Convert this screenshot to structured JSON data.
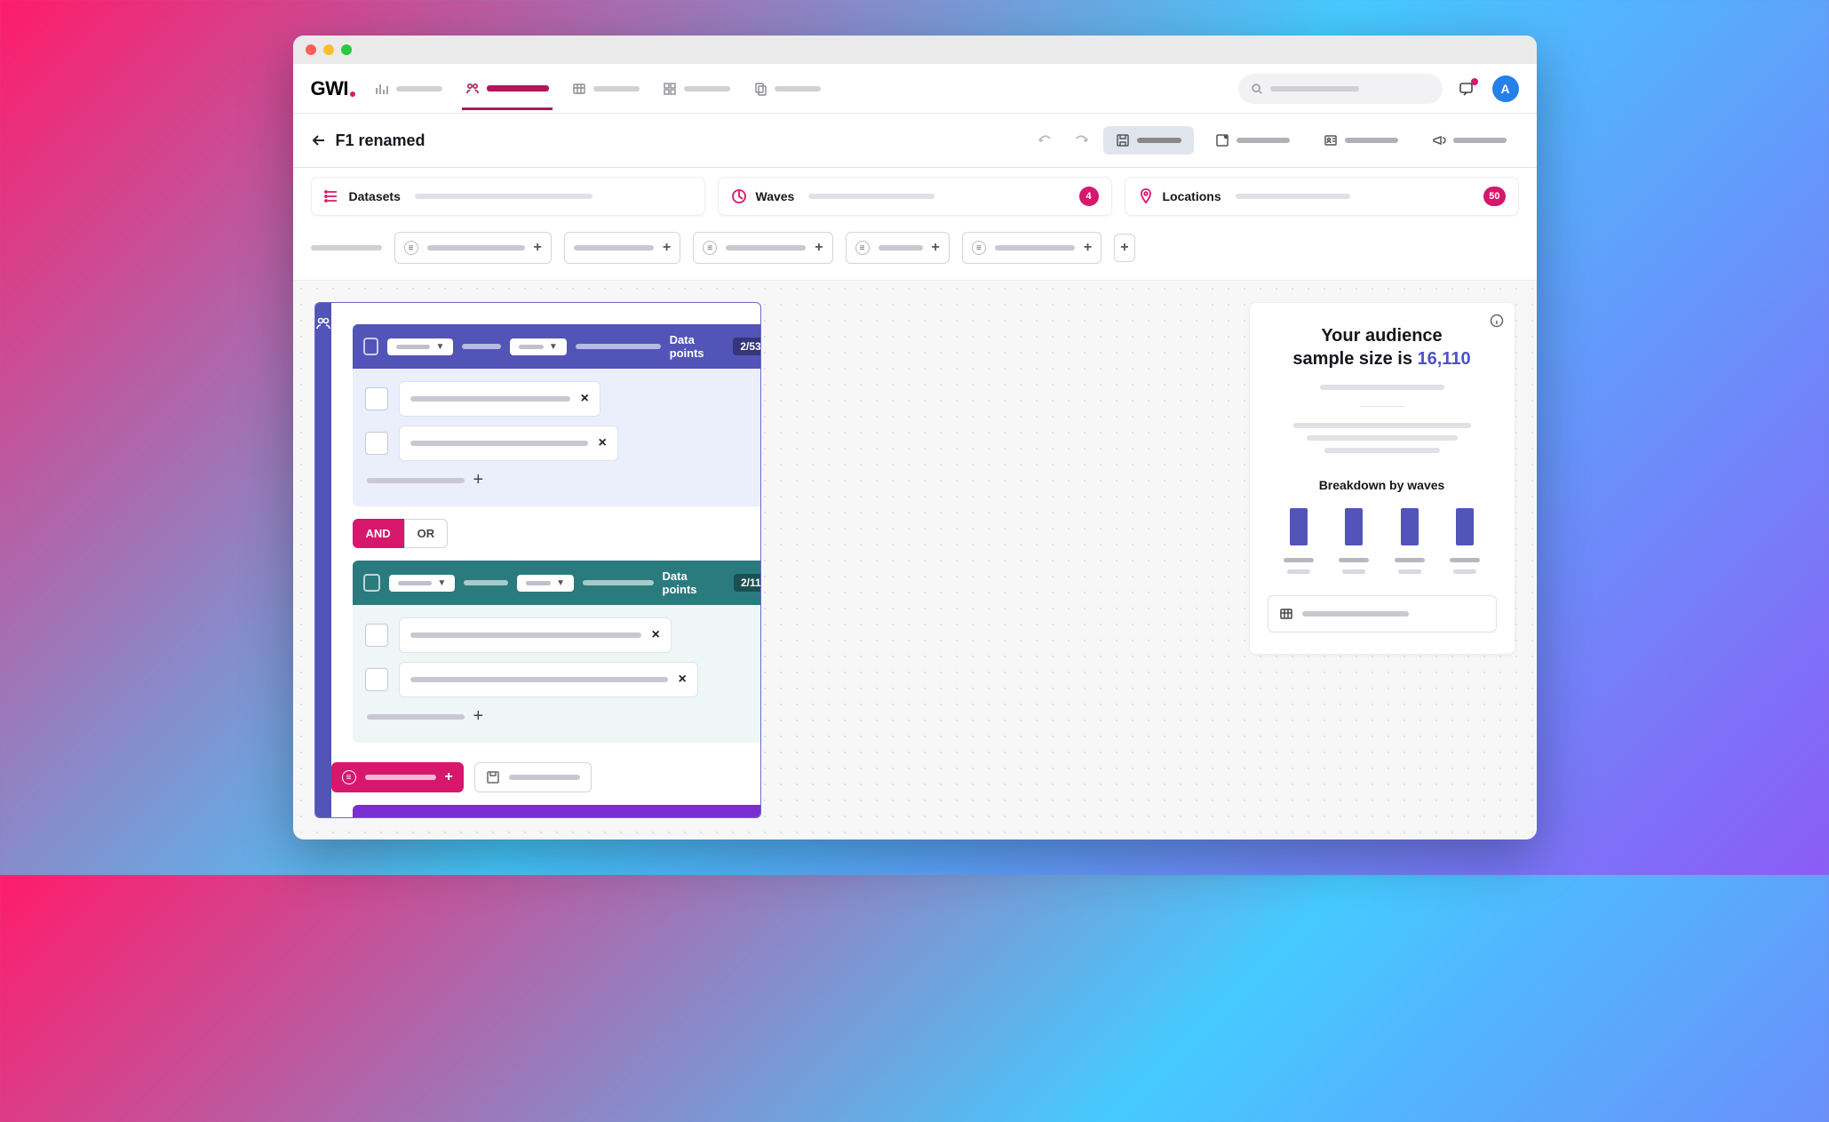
{
  "brand": "GWI",
  "avatar_initial": "A",
  "page_title": "F1 renamed",
  "filters": {
    "datasets": {
      "label": "Datasets"
    },
    "waves": {
      "label": "Waves",
      "badge": "4"
    },
    "locations": {
      "label": "Locations",
      "badge": "50"
    }
  },
  "connector": {
    "and": "AND",
    "or": "OR"
  },
  "segments": [
    {
      "color": "purple",
      "dp_label": "Data points",
      "dp_count": "2/53"
    },
    {
      "color": "teal",
      "dp_label": "Data points",
      "dp_count": "2/11"
    }
  ],
  "sidepanel": {
    "line1": "Your audience",
    "line2_prefix": "sample size is ",
    "number": "16,110",
    "breakdown_title": "Breakdown by waves"
  },
  "chart_data": {
    "type": "bar",
    "title": "Breakdown by waves",
    "categories": [
      "",
      "",
      "",
      ""
    ],
    "values": [
      42,
      42,
      42,
      42
    ],
    "ylim": [
      0,
      50
    ]
  }
}
